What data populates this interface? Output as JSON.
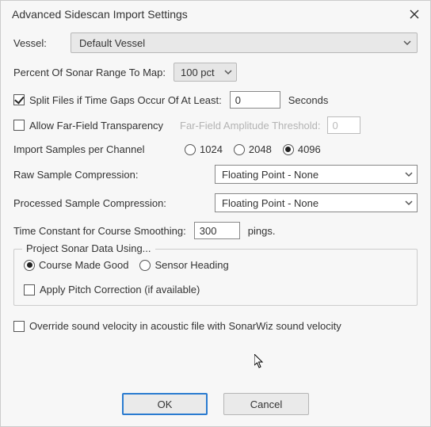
{
  "window": {
    "title": "Advanced Sidescan Import Settings"
  },
  "vessel": {
    "label": "Vessel:",
    "value": "Default Vessel"
  },
  "pctRange": {
    "label": "Percent Of Sonar Range To Map:",
    "value": "100 pct"
  },
  "splitFiles": {
    "label": "Split Files if Time Gaps Occur Of At Least:",
    "value": "0",
    "unit": "Seconds"
  },
  "farField": {
    "label": "Allow Far-Field Transparency",
    "threshLabel": "Far-Field Amplitude Threshold:",
    "threshValue": "0"
  },
  "samples": {
    "label": "Import Samples per Channel",
    "options": [
      "1024",
      "2048",
      "4096"
    ],
    "selected": "4096"
  },
  "rawComp": {
    "label": "Raw Sample Compression:",
    "value": "Floating Point - None"
  },
  "procComp": {
    "label": "Processed Sample Compression:",
    "value": "Floating Point - None"
  },
  "timeConst": {
    "label": "Time Constant for Course Smoothing:",
    "value": "300",
    "unit": "pings."
  },
  "project": {
    "legend": "Project Sonar Data Using...",
    "options": [
      "Course Made Good",
      "Sensor Heading"
    ],
    "selected": "Course Made Good",
    "pitch": "Apply Pitch Correction (if available)"
  },
  "override": {
    "label": "Override sound velocity in acoustic file with SonarWiz sound velocity"
  },
  "buttons": {
    "ok": "OK",
    "cancel": "Cancel"
  }
}
